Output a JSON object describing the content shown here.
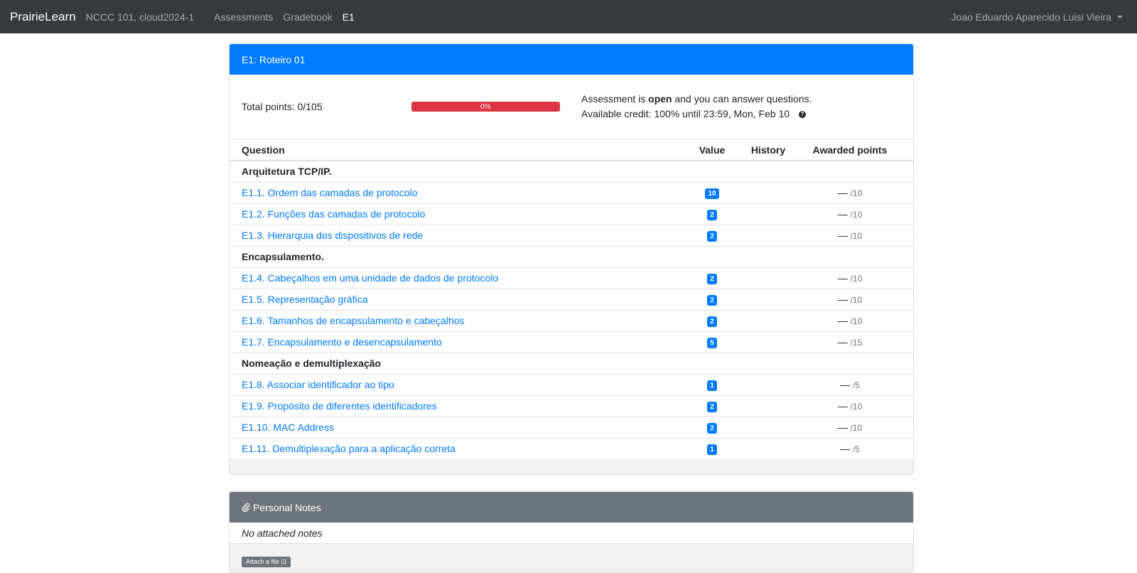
{
  "navbar": {
    "brand": "PrairieLearn",
    "course": "NCCC 101, cloud2024-1",
    "links": [
      {
        "label": "Assessments"
      },
      {
        "label": "Gradebook"
      },
      {
        "label": "E1"
      }
    ],
    "user": "Joao Eduardo Aparecido Luisi Vieira"
  },
  "assessment": {
    "title": "E1: Roteiro 01",
    "total_points": "Total points: 0/105",
    "progress": {
      "label": "0%",
      "value": 0
    },
    "status_pre": "Assessment is ",
    "status_bold": "open",
    "status_post": " and you can answer questions.",
    "credit": "Available credit: 100% until 23:59, Mon, Feb 10",
    "help_icon": "?"
  },
  "table": {
    "headers": {
      "question": "Question",
      "value": "Value",
      "history": "History",
      "awarded": "Awarded points"
    },
    "groups": [
      {
        "title": "Arquitetura TCP/IP.",
        "questions": [
          {
            "label": "E1.1. Ordem das camadas de protocolo",
            "value": "10",
            "dash": "—",
            "max": "/10"
          },
          {
            "label": "E1.2. Funções das camadas de protocolo",
            "value": "2",
            "dash": "—",
            "max": "/10"
          },
          {
            "label": "E1.3. Hierarquia dos dispositivos de rede",
            "value": "2",
            "dash": "—",
            "max": "/10"
          }
        ]
      },
      {
        "title": "Encapsulamento.",
        "questions": [
          {
            "label": "E1.4. Cabeçalhos em uma unidade de dados de protocolo",
            "value": "2",
            "dash": "—",
            "max": "/10"
          },
          {
            "label": "E1.5. Representação gráfica",
            "value": "2",
            "dash": "—",
            "max": "/10"
          },
          {
            "label": "E1.6. Tamanhos de encapsulamento e cabeçalhos",
            "value": "2",
            "dash": "—",
            "max": "/10"
          },
          {
            "label": "E1.7. Encapsulamento e desencapsulamento",
            "value": "5",
            "dash": "—",
            "max": "/15"
          }
        ]
      },
      {
        "title": "Nomeação e demultiplexação",
        "questions": [
          {
            "label": "E1.8. Associar identificador ao tipo",
            "value": "1",
            "dash": "—",
            "max": "/5"
          },
          {
            "label": "E1.9. Propósito de diferentes identificadores",
            "value": "2",
            "dash": "—",
            "max": "/10"
          },
          {
            "label": "E1.10. MAC Address",
            "value": "2",
            "dash": "—",
            "max": "/10"
          },
          {
            "label": "E1.11. Demultiplexação para a aplicação correta",
            "value": "1",
            "dash": "—",
            "max": "/5"
          }
        ]
      }
    ]
  },
  "notes": {
    "title": "Personal Notes",
    "icon": "paperclip-icon",
    "empty": "No attached notes",
    "attach_label": "Attach a file"
  },
  "colors": {
    "navbar": "#343a40",
    "primary": "#007bff",
    "danger": "#dc3545",
    "secondary": "#6c757d"
  }
}
